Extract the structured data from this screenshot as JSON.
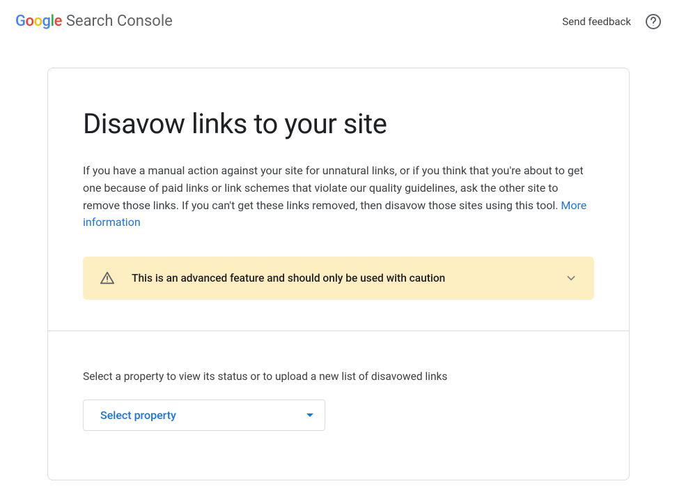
{
  "header": {
    "logo_letters": [
      "G",
      "o",
      "o",
      "g",
      "l",
      "e"
    ],
    "product_name": "Search Console",
    "feedback": "Send feedback"
  },
  "main": {
    "title": "Disavow links to your site",
    "intro": "If you have a manual action against your site for unnatural links, or if you think that you're about to get one because of paid links or link schemes that violate our quality guidelines, ask the other site to remove those links. If you can't get these links removed, then disavow those sites using this tool. ",
    "more_info": "More information",
    "warning": "This is an advanced feature and should only be used with caution",
    "select_label": "Select a property to view its status or to upload a new list of disavowed links",
    "dropdown_placeholder": "Select property"
  }
}
